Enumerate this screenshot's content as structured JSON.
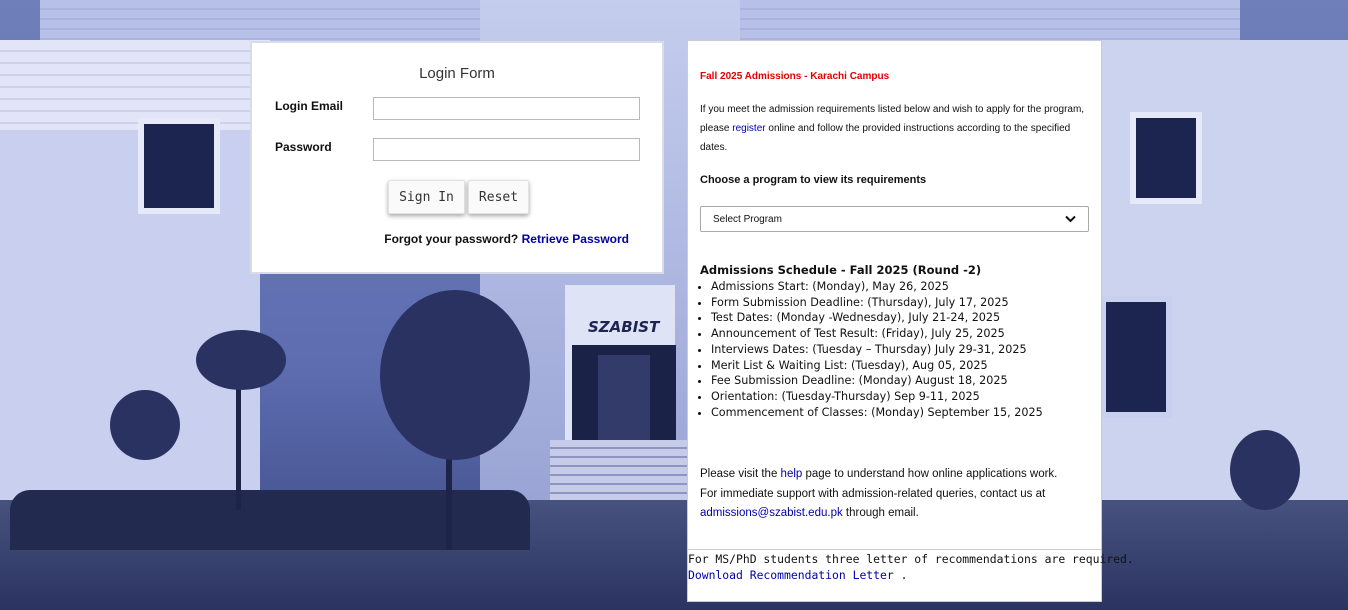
{
  "login_form": {
    "title": "Login Form",
    "email_label": "Login Email",
    "email_value": "",
    "password_label": "Password",
    "password_value": "",
    "sign_in_label": "Sign In",
    "reset_label": "Reset",
    "forgot_text": "Forgot your password?",
    "retrieve_link": "Retrieve Password"
  },
  "background": {
    "sign_text": "SZABIST"
  },
  "admissions": {
    "title": "Fall 2025 Admissions - Karachi Campus",
    "intro_part1": "If you meet the admission requirements listed below and wish to apply for the program, please ",
    "register_link": "register",
    "intro_part2": " online and follow the provided instructions according to the specified dates.",
    "choose_label": "Choose a program to view its requirements",
    "program_select": {
      "selected": "Select Program"
    },
    "schedule_title": "Admissions Schedule - Fall 2025 (Round -2)",
    "schedule": [
      "Admissions Start: (Monday), May 26, 2025",
      "Form Submission Deadline: (Thursday), July 17, 2025",
      "Test Dates: (Monday -Wednesday), July 21-24, 2025",
      "Announcement of Test Result: (Friday), July 25, 2025",
      "Interviews Dates: (Tuesday – Thursday) July 29-31, 2025",
      "Merit List & Waiting List: (Tuesday), Aug 05, 2025",
      "Fee Submission Deadline: (Monday) August 18, 2025",
      "Orientation: (Tuesday-Thursday) Sep 9-11, 2025",
      "Commencement of Classes: (Monday) September 15, 2025"
    ],
    "support": {
      "visit_prefix": "Please visit the ",
      "help_link": "help",
      "visit_suffix": " page to understand how online applications work.",
      "contact_text": "For immediate support with admission-related queries, contact us at",
      "email_link": "admissions@szabist.edu.pk",
      "email_suffix": " through email."
    },
    "msphd_text": "For MS/PhD students three letter of recommendations are required.",
    "download_link": "Download Recommendation Letter",
    "download_suffix": " ."
  },
  "colors": {
    "admissions_title": "#e00000",
    "link": "#0000aa",
    "background_tint": "#3f4f8e"
  },
  "icons": {
    "select_arrow": "chevron-down-icon"
  }
}
